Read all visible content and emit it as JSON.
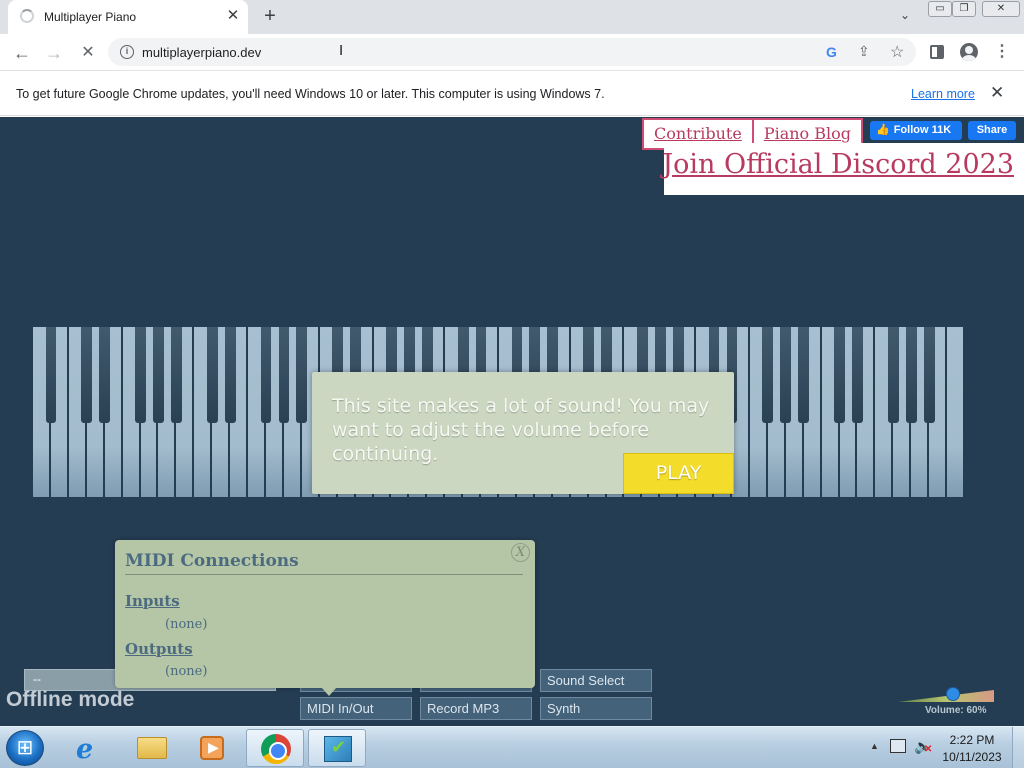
{
  "browser": {
    "tab": {
      "title": "Multiplayer Piano",
      "close": "✕"
    },
    "new_tab": "+",
    "tab_search": "⌄",
    "window": {
      "minimize": "▭",
      "maximize": "❐",
      "close": "✕"
    },
    "nav": {
      "back": "←",
      "forward": "→",
      "reload": "✕"
    },
    "address": {
      "url": "multiplayerpiano.dev",
      "info": "i"
    },
    "toolbar_icons": {
      "google": "G",
      "share": "⇪",
      "bookmark": "☆",
      "menu": "⋮"
    }
  },
  "infobar": {
    "message": "To get future Google Chrome updates, you'll need Windows 10 or later. This computer is using Windows 7.",
    "learn_more": "Learn more",
    "close": "✕"
  },
  "page": {
    "links": {
      "contribute": "Contribute",
      "blog": "Piano Blog",
      "discord": "Join Official Discord 2023"
    },
    "facebook": {
      "follow": "Follow 11K",
      "share": "Share"
    },
    "notice": {
      "text": "This site makes a lot of sound! You may want to adjust the volume before continuing.",
      "play": "PLAY"
    },
    "midi": {
      "title": "MIDI Connections",
      "close": "X",
      "inputs_label": "Inputs",
      "inputs_value": "(none)",
      "outputs_label": "Outputs",
      "outputs_value": "(none)"
    },
    "buttons": {
      "sound_select": "Sound Select",
      "midi": "MIDI In/Out",
      "record": "Record MP3",
      "synth": "Synth"
    },
    "left_box_text": "--",
    "status": "Offline mode",
    "volume": {
      "label": "Volume: 60%",
      "level": 0.6
    },
    "colors": {
      "background": "#243d53",
      "accent_link": "#b83a60",
      "play_button": "#f4dc2a"
    }
  },
  "taskbar": {
    "time": "2:22 PM",
    "date": "10/11/2023",
    "apps": [
      "internet-explorer",
      "windows-explorer",
      "media-player",
      "chrome",
      "tool"
    ]
  }
}
